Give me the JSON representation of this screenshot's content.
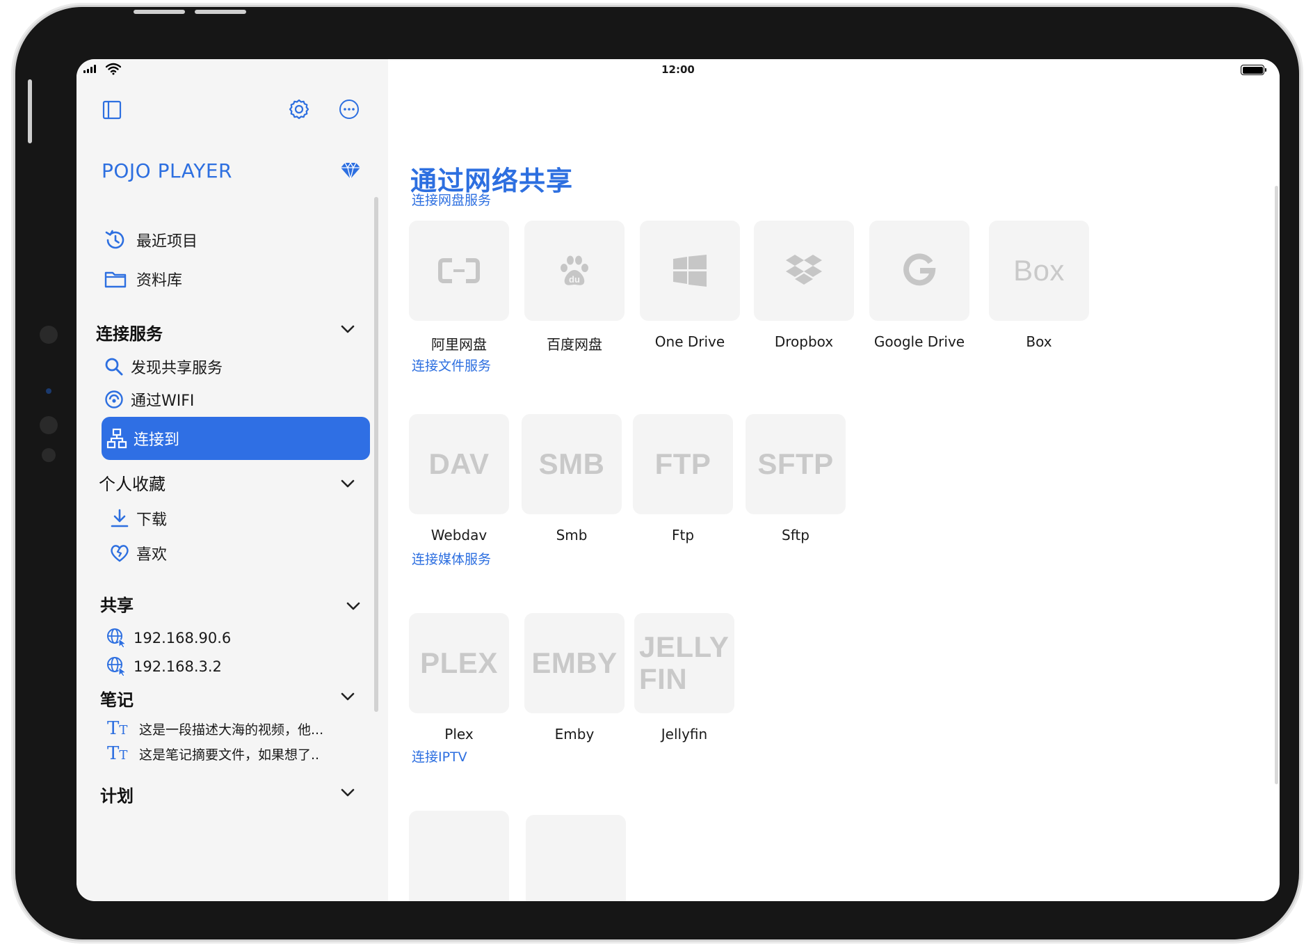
{
  "status_bar": {
    "time": "12:00"
  },
  "sidebar": {
    "app_title": "POJO PLAYER",
    "top_items": [
      {
        "label": "最近项目",
        "icon": "history-icon"
      },
      {
        "label": "资料库",
        "icon": "folder-icon"
      }
    ],
    "sections": {
      "connect": {
        "title": "连接服务",
        "items": [
          {
            "label": "发现共享服务",
            "icon": "search-icon"
          },
          {
            "label": "通过WIFI",
            "icon": "wifi-signal-icon"
          },
          {
            "label": "连接到",
            "icon": "network-icon",
            "active": true
          }
        ]
      },
      "favorites": {
        "title": "个人收藏",
        "items": [
          {
            "label": "下载",
            "icon": "download-icon"
          },
          {
            "label": "喜欢",
            "icon": "heart-icon"
          }
        ]
      },
      "share": {
        "title": "共享",
        "items": [
          {
            "label": "192.168.90.6",
            "icon": "globe-pointer-icon"
          },
          {
            "label": "192.168.3.2",
            "icon": "globe-pointer-icon"
          }
        ]
      },
      "notes": {
        "title": "笔记",
        "items": [
          {
            "label": "这是一段描述大海的视频，他...",
            "icon": "text-icon"
          },
          {
            "label": "这是笔记摘要文件，如果想了..",
            "icon": "text-icon"
          }
        ]
      },
      "plan": {
        "title": "计划"
      }
    }
  },
  "main": {
    "title": "通过网络共享",
    "groups": [
      {
        "title": "连接网盘服务",
        "items": [
          {
            "label": "阿里网盘",
            "icon": "aliyun-icon"
          },
          {
            "label": "百度网盘",
            "icon": "baidu-icon"
          },
          {
            "label": "One Drive",
            "icon": "windows-icon"
          },
          {
            "label": "Dropbox",
            "icon": "dropbox-icon"
          },
          {
            "label": "Google Drive",
            "icon": "google-icon"
          },
          {
            "label": "Box",
            "logo_text": "Box"
          }
        ]
      },
      {
        "title": "连接文件服务",
        "items": [
          {
            "label": "Webdav",
            "logo_text": "DAV"
          },
          {
            "label": "Smb",
            "logo_text": "SMB"
          },
          {
            "label": "Ftp",
            "logo_text": "FTP"
          },
          {
            "label": "Sftp",
            "logo_text": "SFTP"
          }
        ]
      },
      {
        "title": "连接媒体服务",
        "items": [
          {
            "label": "Plex",
            "logo_text": "PLEX"
          },
          {
            "label": "Emby",
            "logo_text": "EMBY"
          },
          {
            "label": "Jellyfin",
            "logo_text_lines": [
              "JELLY",
              "FIN"
            ]
          }
        ]
      },
      {
        "title": "连接IPTV",
        "items": []
      }
    ]
  },
  "colors": {
    "accent": "#2f6fe4",
    "sidebar_bg": "#f5f5f5",
    "tile_bg": "#f4f4f4",
    "logo_grey": "#c9c9c9"
  }
}
